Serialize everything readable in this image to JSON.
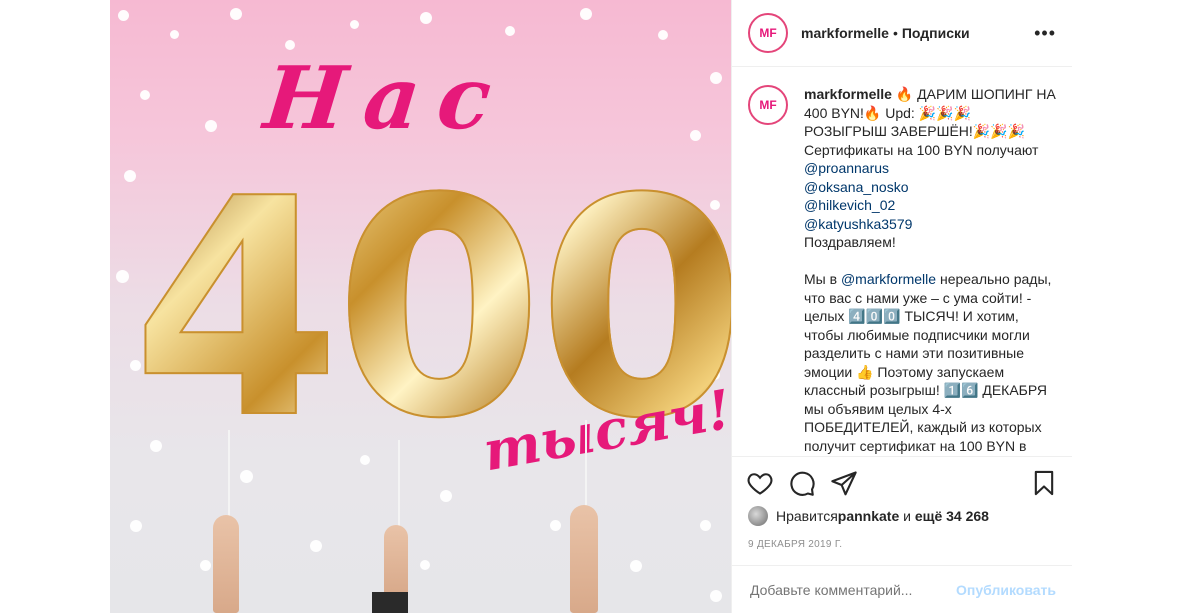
{
  "post": {
    "image": {
      "headline": "Нас",
      "number": "400",
      "subtext": "тысяч!"
    },
    "header": {
      "username": "markformelle",
      "separator": "•",
      "follow_label": "Подписки",
      "more": "•••",
      "avatar_logo": "MF"
    },
    "caption": {
      "username": "markformelle",
      "line1": " 🔥 ДАРИМ ШОПИНГ НА 400 BYN!🔥 Upd: 🎉🎉🎉 РОЗЫГРЫШ ЗАВЕРШЁН!🎉🎉🎉",
      "line2": "Сертификаты на 100 BYN получают",
      "mentions": [
        "@proannarus",
        "@oksana_nosko",
        "@hilkevich_02",
        "@katyushka3579"
      ],
      "congrats": "Поздравляем!",
      "body_prefix": "Мы в ",
      "body_mention": "@markformelle",
      "body_rest": " нереально рады, что вас с нами уже – с ума сойти! - целых 4️⃣0️⃣0️⃣ ТЫСЯЧ! И хотим, чтобы любимые подписчики могли разделить с нами эти позитивные эмоции 👍 Поэтому запускаем классный розыгрыш! 1️⃣6️⃣ ДЕКАБРЯ мы объявим целых 4-х ПОБЕДИТЕЛЕЙ, каждый из которых получит сертификат на 100 BYN в"
    },
    "likes": {
      "prefix": "Нравится ",
      "user": "pannkate",
      "middle": " и ",
      "count": "ещё 34 268"
    },
    "date": "9 ДЕКАБРЯ 2019 Г.",
    "comment_input": {
      "placeholder": "Добавьте комментарий...",
      "publish_label": "Опубликовать"
    },
    "icons": [
      "heart-icon",
      "comment-icon",
      "share-icon",
      "bookmark-icon",
      "more-icon"
    ],
    "colors": {
      "brand_pink": "#e6197a",
      "link": "#00376b",
      "publish_disabled": "#b3dbff",
      "meta_gray": "#8e8e8e"
    }
  }
}
